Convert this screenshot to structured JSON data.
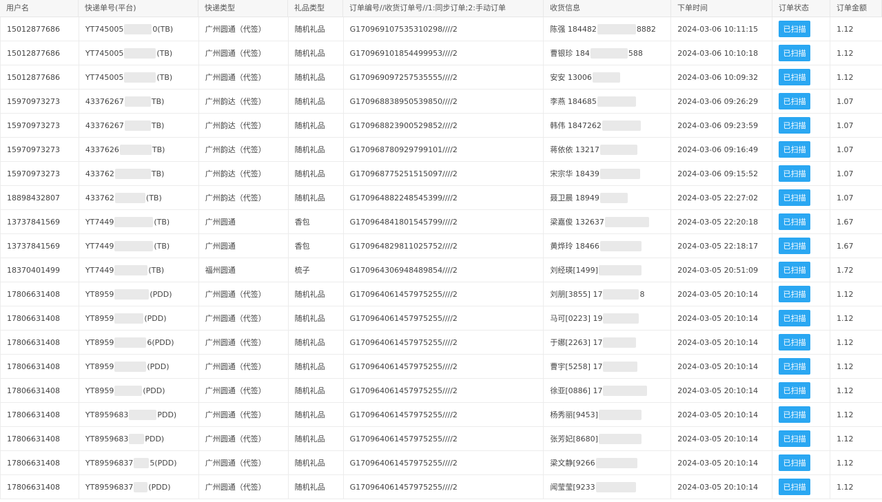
{
  "headers": {
    "user": "用户名",
    "track": "快递单号(平台)",
    "type": "快递类型",
    "gift": "礼品类型",
    "order": "订单编号//收货订单号//1:同步订单;2:手动订单",
    "recv": "收货信息",
    "time": "下单时间",
    "status": "订单状态",
    "amount": "订单金额"
  },
  "rows": [
    {
      "user": "15012877686",
      "track_a": "YT745005",
      "track_b": "0(TB)",
      "type": "广州圆通（代签）",
      "gift": "随机礼品",
      "order": "G170969107535310298////2",
      "recv_a": "陈强 184482",
      "recv_b": "8882",
      "time": "2024-03-06 10:11:15",
      "status": "已扫描",
      "amount": "1.12"
    },
    {
      "user": "15012877686",
      "track_a": "YT745005",
      "track_b": "(TB)",
      "type": "广州圆通（代签）",
      "gift": "随机礼品",
      "order": "G170969101854499953////2",
      "recv_a": "曹银珍 184",
      "recv_b": "588",
      "time": "2024-03-06 10:10:18",
      "status": "已扫描",
      "amount": "1.12"
    },
    {
      "user": "15012877686",
      "track_a": "YT745005",
      "track_b": "(TB)",
      "type": "广州圆通（代签）",
      "gift": "随机礼品",
      "order": "G170969097257535555////2",
      "recv_a": "安安 13006",
      "recv_b": "",
      "time": "2024-03-06 10:09:32",
      "status": "已扫描",
      "amount": "1.12"
    },
    {
      "user": "15970973273",
      "track_a": "43376267",
      "track_b": "TB)",
      "type": "广州韵达（代签）",
      "gift": "随机礼品",
      "order": "G170968838950539850////2",
      "recv_a": "李燕 184685",
      "recv_b": "",
      "time": "2024-03-06 09:26:29",
      "status": "已扫描",
      "amount": "1.07"
    },
    {
      "user": "15970973273",
      "track_a": "43376267",
      "track_b": "TB)",
      "type": "广州韵达（代签）",
      "gift": "随机礼品",
      "order": "G170968823900529852////2",
      "recv_a": "韩伟 1847262",
      "recv_b": "",
      "time": "2024-03-06 09:23:59",
      "status": "已扫描",
      "amount": "1.07"
    },
    {
      "user": "15970973273",
      "track_a": "4337626",
      "track_b": "TB)",
      "type": "广州韵达（代签）",
      "gift": "随机礼品",
      "order": "G170968780929799101////2",
      "recv_a": "蒋依依 13217",
      "recv_b": "",
      "time": "2024-03-06 09:16:49",
      "status": "已扫描",
      "amount": "1.07"
    },
    {
      "user": "15970973273",
      "track_a": "433762",
      "track_b": "TB)",
      "type": "广州韵达（代签）",
      "gift": "随机礼品",
      "order": "G170968775251515097////2",
      "recv_a": "宋宗华 18439",
      "recv_b": "",
      "time": "2024-03-06 09:15:52",
      "status": "已扫描",
      "amount": "1.07"
    },
    {
      "user": "18898432807",
      "track_a": "433762",
      "track_b": "(TB)",
      "type": "广州韵达（代签）",
      "gift": "随机礼品",
      "order": "G170964882248545399////2",
      "recv_a": "聂卫晨 18949",
      "recv_b": "",
      "time": "2024-03-05 22:27:02",
      "status": "已扫描",
      "amount": "1.07"
    },
    {
      "user": "13737841569",
      "track_a": "YT7449",
      "track_b": "(TB)",
      "type": "广州圆通",
      "gift": "香包",
      "order": "G170964841801545799////2",
      "recv_a": "梁嘉俊 132637",
      "recv_b": "",
      "time": "2024-03-05 22:20:18",
      "status": "已扫描",
      "amount": "1.67"
    },
    {
      "user": "13737841569",
      "track_a": "YT7449",
      "track_b": "(TB)",
      "type": "广州圆通",
      "gift": "香包",
      "order": "G170964829811025752////2",
      "recv_a": "黄烨玲 18466",
      "recv_b": "",
      "time": "2024-03-05 22:18:17",
      "status": "已扫描",
      "amount": "1.67"
    },
    {
      "user": "18370401499",
      "track_a": "YT7449",
      "track_b": "(TB)",
      "type": "福州圆通",
      "gift": "梳子",
      "order": "G170964306948489854////2",
      "recv_a": "刘经瑛[1499]",
      "recv_b": "",
      "time": "2024-03-05 20:51:09",
      "status": "已扫描",
      "amount": "1.72"
    },
    {
      "user": "17806631408",
      "track_a": "YT8959",
      "track_b": "(PDD)",
      "type": "广州圆通（代签）",
      "gift": "随机礼品",
      "order": "G170964061457975255////2",
      "recv_a": "刘朋[3855] 17",
      "recv_b": "8",
      "time": "2024-03-05 20:10:14",
      "status": "已扫描",
      "amount": "1.12"
    },
    {
      "user": "17806631408",
      "track_a": "YT8959",
      "track_b": "(PDD)",
      "type": "广州圆通（代签）",
      "gift": "随机礼品",
      "order": "G170964061457975255////2",
      "recv_a": "马可[0223] 19",
      "recv_b": "",
      "time": "2024-03-05 20:10:14",
      "status": "已扫描",
      "amount": "1.12"
    },
    {
      "user": "17806631408",
      "track_a": "YT8959",
      "track_b": "6(PDD)",
      "type": "广州圆通（代签）",
      "gift": "随机礼品",
      "order": "G170964061457975255////2",
      "recv_a": "于娜[2263] 17",
      "recv_b": "",
      "time": "2024-03-05 20:10:14",
      "status": "已扫描",
      "amount": "1.12"
    },
    {
      "user": "17806631408",
      "track_a": "YT8959",
      "track_b": "(PDD)",
      "type": "广州圆通（代签）",
      "gift": "随机礼品",
      "order": "G170964061457975255////2",
      "recv_a": "曹宇[5258] 17",
      "recv_b": "",
      "time": "2024-03-05 20:10:14",
      "status": "已扫描",
      "amount": "1.12"
    },
    {
      "user": "17806631408",
      "track_a": "YT8959",
      "track_b": "(PDD)",
      "type": "广州圆通（代签）",
      "gift": "随机礼品",
      "order": "G170964061457975255////2",
      "recv_a": "徐亚[0886] 17",
      "recv_b": "",
      "time": "2024-03-05 20:10:14",
      "status": "已扫描",
      "amount": "1.12"
    },
    {
      "user": "17806631408",
      "track_a": "YT8959683",
      "track_b": "PDD)",
      "type": "广州圆通（代签）",
      "gift": "随机礼品",
      "order": "G170964061457975255////2",
      "recv_a": "杨秀丽[9453]",
      "recv_b": "",
      "time": "2024-03-05 20:10:14",
      "status": "已扫描",
      "amount": "1.12"
    },
    {
      "user": "17806631408",
      "track_a": "YT8959683",
      "track_b": "PDD)",
      "type": "广州圆通（代签）",
      "gift": "随机礼品",
      "order": "G170964061457975255////2",
      "recv_a": "张芳妃[8680]",
      "recv_b": "",
      "time": "2024-03-05 20:10:14",
      "status": "已扫描",
      "amount": "1.12"
    },
    {
      "user": "17806631408",
      "track_a": "YT89596837",
      "track_b": "5(PDD)",
      "type": "广州圆通（代签）",
      "gift": "随机礼品",
      "order": "G170964061457975255////2",
      "recv_a": "梁文静[9266",
      "recv_b": "",
      "time": "2024-03-05 20:10:14",
      "status": "已扫描",
      "amount": "1.12"
    },
    {
      "user": "17806631408",
      "track_a": "YT89596837",
      "track_b": "(PDD)",
      "type": "广州圆通（代签）",
      "gift": "随机礼品",
      "order": "G170964061457975255////2",
      "recv_a": "闻莹莹[9233",
      "recv_b": "",
      "time": "2024-03-05 20:10:14",
      "status": "已扫描",
      "amount": "1.12"
    }
  ]
}
